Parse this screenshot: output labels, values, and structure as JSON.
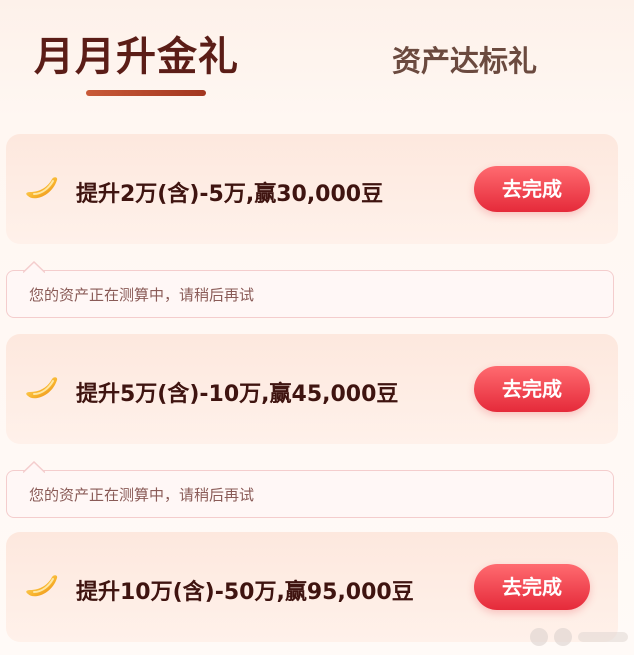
{
  "tabs": {
    "active_label": "月月升金礼",
    "inactive_label": "资产达标礼"
  },
  "tasks": [
    {
      "title": "提升2万(含)-5万,赢30,000豆",
      "button_label": "去完成",
      "tip": "您的资产正在测算中，请稍后再试"
    },
    {
      "title": "提升5万(含)-10万,赢45,000豆",
      "button_label": "去完成",
      "tip": "您的资产正在测算中，请稍后再试"
    },
    {
      "title": "提升10万(含)-50万,赢95,000豆",
      "button_label": "去完成"
    }
  ],
  "icons": {
    "task_icon": "golden-bean-icon"
  },
  "colors": {
    "accent_red": "#e52a3a",
    "title_dark": "#5b1d17",
    "underline": "#a2361f",
    "tip_text": "#8a5b57"
  }
}
